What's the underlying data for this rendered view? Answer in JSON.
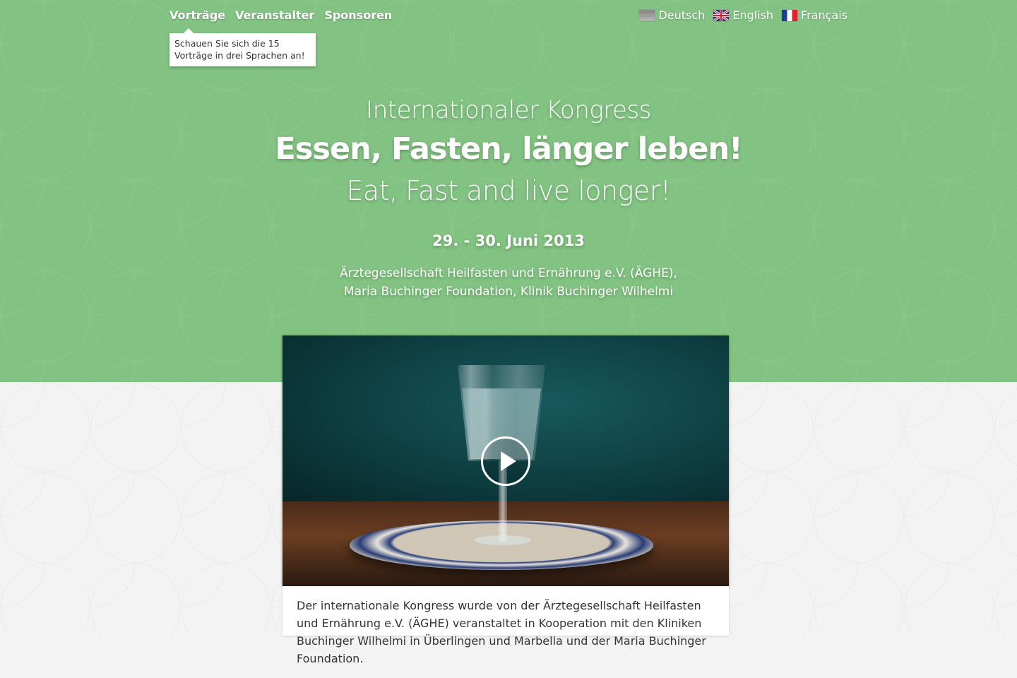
{
  "nav": {
    "items": [
      "Vorträge",
      "Veranstalter",
      "Sponsoren"
    ],
    "tooltip": "Schauen Sie sich die 15 Vorträge in drei Sprachen an!"
  },
  "languages": [
    {
      "label": "Deutsch",
      "flag": "de-flag-icon"
    },
    {
      "label": "English",
      "flag": "uk-flag-icon"
    },
    {
      "label": "Français",
      "flag": "fr-flag-icon"
    }
  ],
  "hero": {
    "subtitle": "Internationaler Kongress",
    "title": "Essen, Fasten, länger leben!",
    "title_en": "Eat, Fast and live longer!",
    "date": "29. - 30. Juni 2013",
    "organizers_line1": "Ärztegesellschaft Heilfasten und Ernährung e.V. (ÄGHE),",
    "organizers_line2": "Maria Buchinger Foundation, Klinik Buchinger Wilhelmi"
  },
  "video": {
    "play_icon": "play-icon"
  },
  "body": {
    "intro": "Der internationale Kongress wurde von der Ärztegesellschaft Heilfasten und Ernährung e.V. (ÄGHE) veranstaltet in Kooperation mit den Kliniken Buchinger Wilhelmi in Überlingen und Marbella und der Maria Buchinger Foundation."
  },
  "colors": {
    "hero_green": "#82c282",
    "background": "#f3f3f3"
  }
}
